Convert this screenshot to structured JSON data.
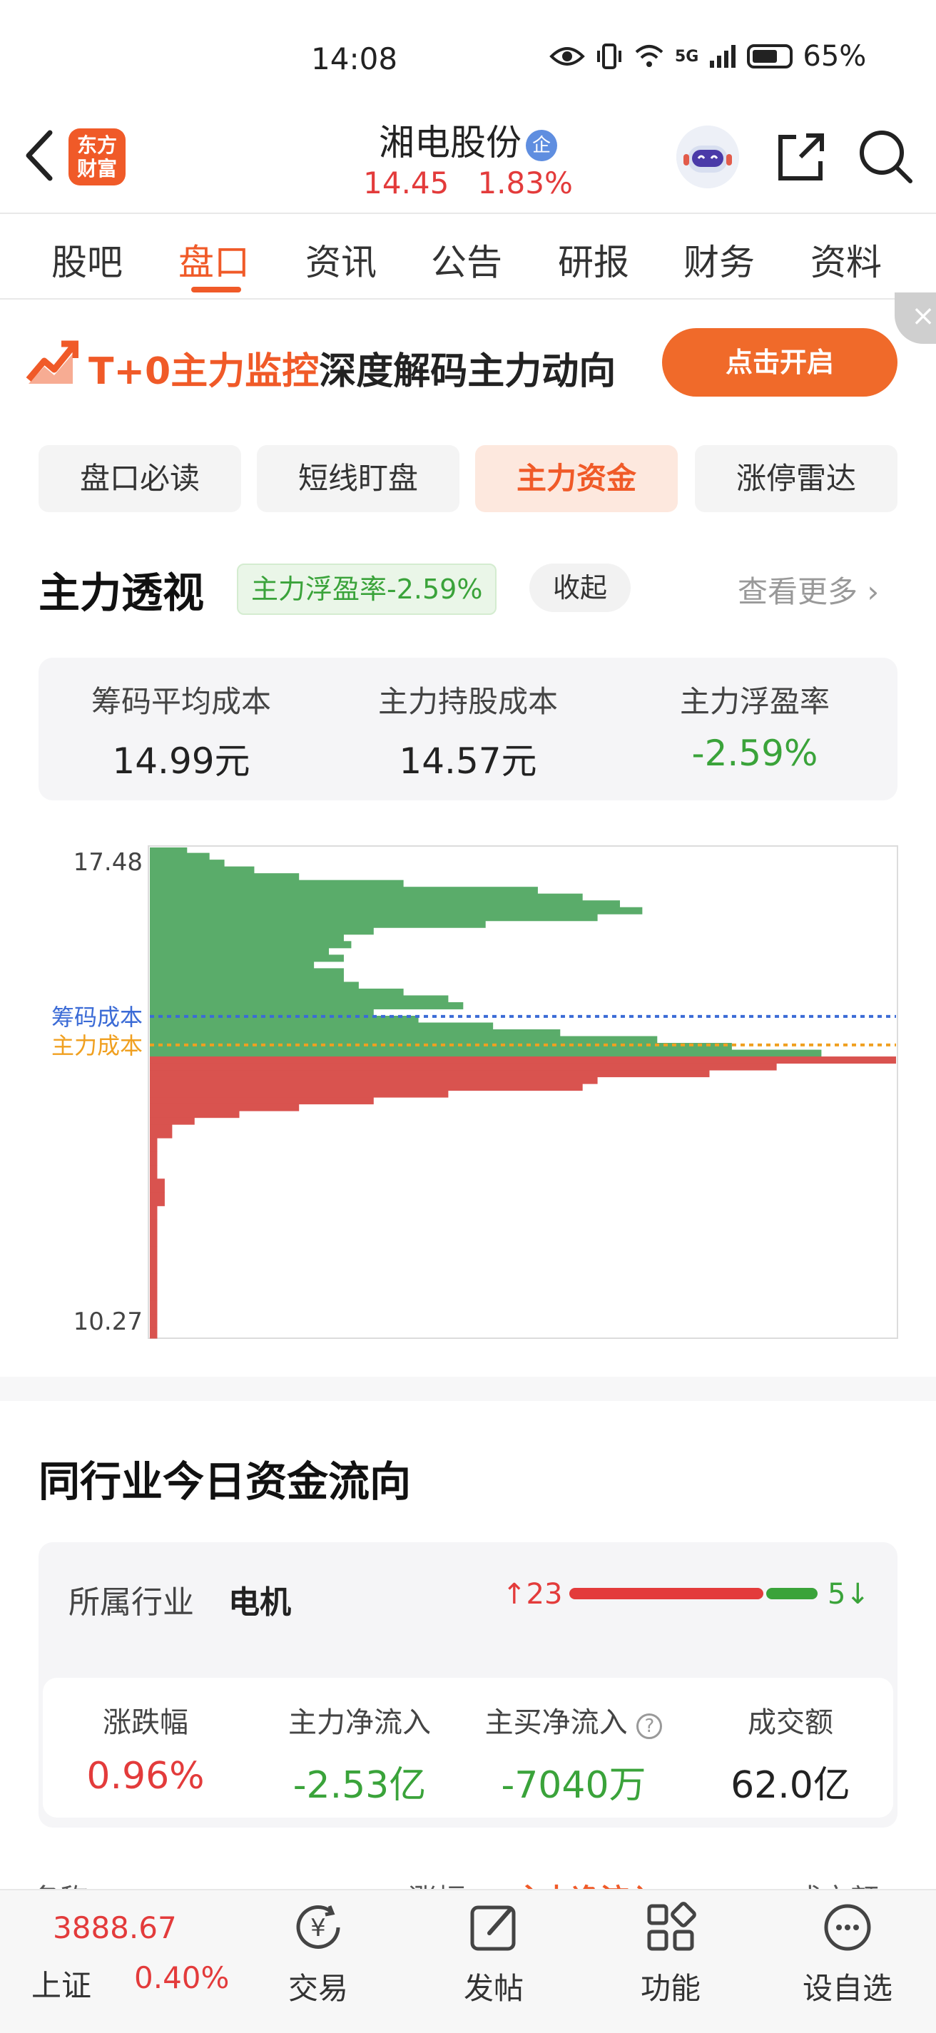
{
  "status_bar": {
    "time": "14:08",
    "network": "5G",
    "battery": "65%"
  },
  "header": {
    "logo_line1": "东方",
    "logo_line2": "财富",
    "stock_name": "湘电股份",
    "badge": "企",
    "price": "14.45",
    "change_pct": "1.83%"
  },
  "tabs": [
    {
      "label": "股吧",
      "active": false
    },
    {
      "label": "盘口",
      "active": true
    },
    {
      "label": "资讯",
      "active": false
    },
    {
      "label": "公告",
      "active": false
    },
    {
      "label": "研报",
      "active": false
    },
    {
      "label": "财务",
      "active": false
    },
    {
      "label": "资料",
      "active": false
    }
  ],
  "banner": {
    "highlight": "T+0主力监控",
    "text": "深度解码主力动向",
    "button": "点击开启"
  },
  "subtabs": [
    "盘口必读",
    "短线盯盘",
    "主力资金",
    "涨停雷达"
  ],
  "perspective": {
    "title": "主力透视",
    "float_badge": "主力浮盈率-2.59%",
    "collapse": "收起",
    "see_more": "查看更多",
    "cost_card": [
      {
        "label": "筹码平均成本",
        "value": "14.99元"
      },
      {
        "label": "主力持股成本",
        "value": "14.57元"
      },
      {
        "label": "主力浮盈率",
        "value": "-2.59%"
      }
    ]
  },
  "chart_data": {
    "type": "bar",
    "orientation": "horizontal",
    "y_top": "17.48",
    "y_bottom": "10.27",
    "ylim": [
      10.27,
      17.48
    ],
    "markers": [
      {
        "label": "筹码成本",
        "value": 14.99,
        "color": "#3b6bd6"
      },
      {
        "label": "主力成本",
        "value": 14.57,
        "color": "#f0a020"
      }
    ],
    "current_price": 14.45,
    "profit_color": "#5aac6a",
    "loss_color": "#d9534f",
    "levels": [
      {
        "price": 17.48,
        "volume": 5
      },
      {
        "price": 17.4,
        "volume": 8
      },
      {
        "price": 17.3,
        "volume": 10
      },
      {
        "price": 17.2,
        "volume": 14
      },
      {
        "price": 17.1,
        "volume": 20
      },
      {
        "price": 17.0,
        "volume": 34
      },
      {
        "price": 16.9,
        "volume": 52
      },
      {
        "price": 16.8,
        "volume": 58
      },
      {
        "price": 16.7,
        "volume": 63
      },
      {
        "price": 16.6,
        "volume": 66
      },
      {
        "price": 16.5,
        "volume": 60
      },
      {
        "price": 16.4,
        "volume": 45
      },
      {
        "price": 16.3,
        "volume": 30
      },
      {
        "price": 16.2,
        "volume": 26
      },
      {
        "price": 16.1,
        "volume": 27
      },
      {
        "price": 16.0,
        "volume": 24
      },
      {
        "price": 15.9,
        "volume": 26
      },
      {
        "price": 15.8,
        "volume": 22
      },
      {
        "price": 15.7,
        "volume": 26
      },
      {
        "price": 15.6,
        "volume": 26
      },
      {
        "price": 15.5,
        "volume": 28
      },
      {
        "price": 15.4,
        "volume": 34
      },
      {
        "price": 15.3,
        "volume": 40
      },
      {
        "price": 15.2,
        "volume": 42
      },
      {
        "price": 15.1,
        "volume": 30
      },
      {
        "price": 15.0,
        "volume": 36
      },
      {
        "price": 14.9,
        "volume": 46
      },
      {
        "price": 14.8,
        "volume": 55
      },
      {
        "price": 14.7,
        "volume": 68
      },
      {
        "price": 14.6,
        "volume": 78
      },
      {
        "price": 14.5,
        "volume": 90
      },
      {
        "price": 14.4,
        "volume": 100
      },
      {
        "price": 14.3,
        "volume": 84
      },
      {
        "price": 14.2,
        "volume": 75
      },
      {
        "price": 14.1,
        "volume": 60
      },
      {
        "price": 14.0,
        "volume": 58
      },
      {
        "price": 13.9,
        "volume": 40
      },
      {
        "price": 13.8,
        "volume": 30
      },
      {
        "price": 13.7,
        "volume": 20
      },
      {
        "price": 13.6,
        "volume": 12
      },
      {
        "price": 13.5,
        "volume": 6
      },
      {
        "price": 13.4,
        "volume": 3
      },
      {
        "price": 13.2,
        "volume": 1
      },
      {
        "price": 13.0,
        "volume": 1
      },
      {
        "price": 12.8,
        "volume": 1
      },
      {
        "price": 12.6,
        "volume": 2
      },
      {
        "price": 12.4,
        "volume": 2
      },
      {
        "price": 12.2,
        "volume": 1
      },
      {
        "price": 12.0,
        "volume": 1
      },
      {
        "price": 11.8,
        "volume": 1
      },
      {
        "price": 11.6,
        "volume": 1
      },
      {
        "price": 11.4,
        "volume": 1
      },
      {
        "price": 11.2,
        "volume": 1
      },
      {
        "price": 11.0,
        "volume": 1
      },
      {
        "price": 10.8,
        "volume": 1
      },
      {
        "price": 10.6,
        "volume": 1
      },
      {
        "price": 10.4,
        "volume": 1
      },
      {
        "price": 10.27,
        "volume": 1
      }
    ]
  },
  "industry": {
    "title": "同行业今日资金流向",
    "industry_label": "所属行业",
    "industry_name": "电机",
    "up_count": "23",
    "down_count": "5",
    "stats": [
      {
        "label": "涨跌幅",
        "value": "0.96%",
        "tone": "red"
      },
      {
        "label": "主力净流入",
        "value": "-2.53亿",
        "tone": "green"
      },
      {
        "label": "主买净流入",
        "value": "-7040万",
        "tone": "green"
      },
      {
        "label": "成交额",
        "value": "62.0亿",
        "tone": "plain"
      }
    ],
    "peek_row": [
      "名称",
      "涨幅",
      "主力净流入",
      "成交额"
    ]
  },
  "bottom_nav": {
    "index_value": "3888.67",
    "index_name": "上证",
    "index_change": "0.40%",
    "items": [
      "交易",
      "发帖",
      "功能",
      "设自选"
    ]
  }
}
